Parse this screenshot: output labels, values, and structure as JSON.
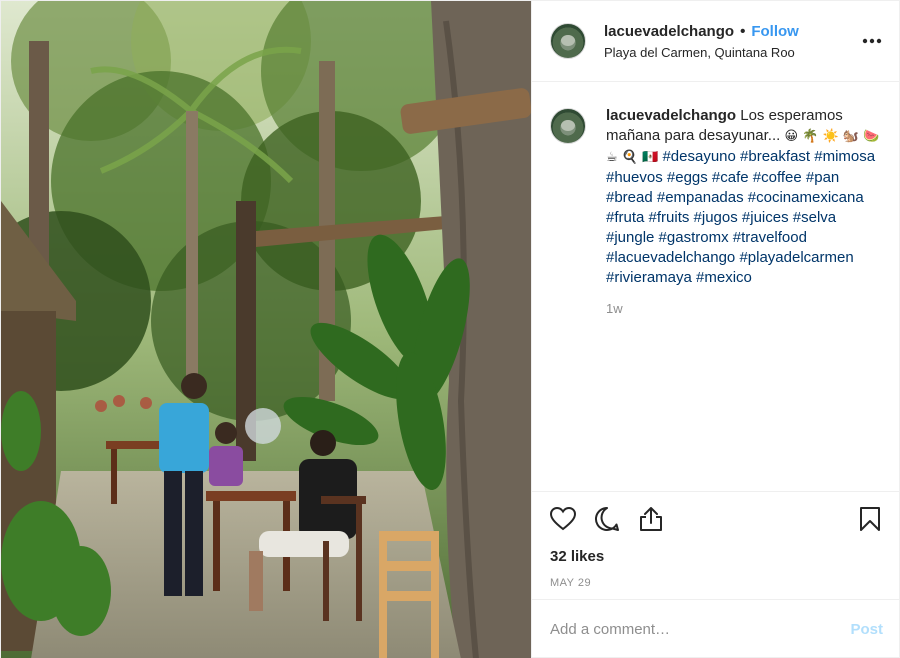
{
  "header": {
    "username": "lacuevadelchango",
    "separator": "•",
    "follow_label": "Follow",
    "location": "Playa del Carmen, Quintana Roo",
    "more_icon": "more-options-icon",
    "more_label": "•••"
  },
  "caption": {
    "username": "lacuevadelchango",
    "text": "Los esperamos mañana para desayunar...",
    "emojis_line1": "😀 🌴 ☀️ 🐿️",
    "emojis_line2": "🍉 ☕ 🍳 🇲🇽",
    "hashtags": "#desayuno #breakfast #mimosa #huevos #eggs #cafe #coffee #pan #bread #empanadas #cocinamexicana #fruta #fruits #jugos #juices #selva #jungle #gastromx #travelfood #lacuevadelchango #playadelcarmen #rivieramaya #mexico",
    "time_ago": "1w"
  },
  "actions": {
    "icons": [
      "heart-icon",
      "comment-icon",
      "share-icon",
      "bookmark-icon"
    ]
  },
  "likes": "32 likes",
  "date": "MAY 29",
  "comment_box": {
    "placeholder": "Add a comment…",
    "post_label": "Post"
  },
  "colors": {
    "link_blue": "#3897f0",
    "hashtag_blue": "#003569",
    "muted": "#8e8e8e",
    "post_disabled": "#b2dffc",
    "border": "#efefef"
  }
}
